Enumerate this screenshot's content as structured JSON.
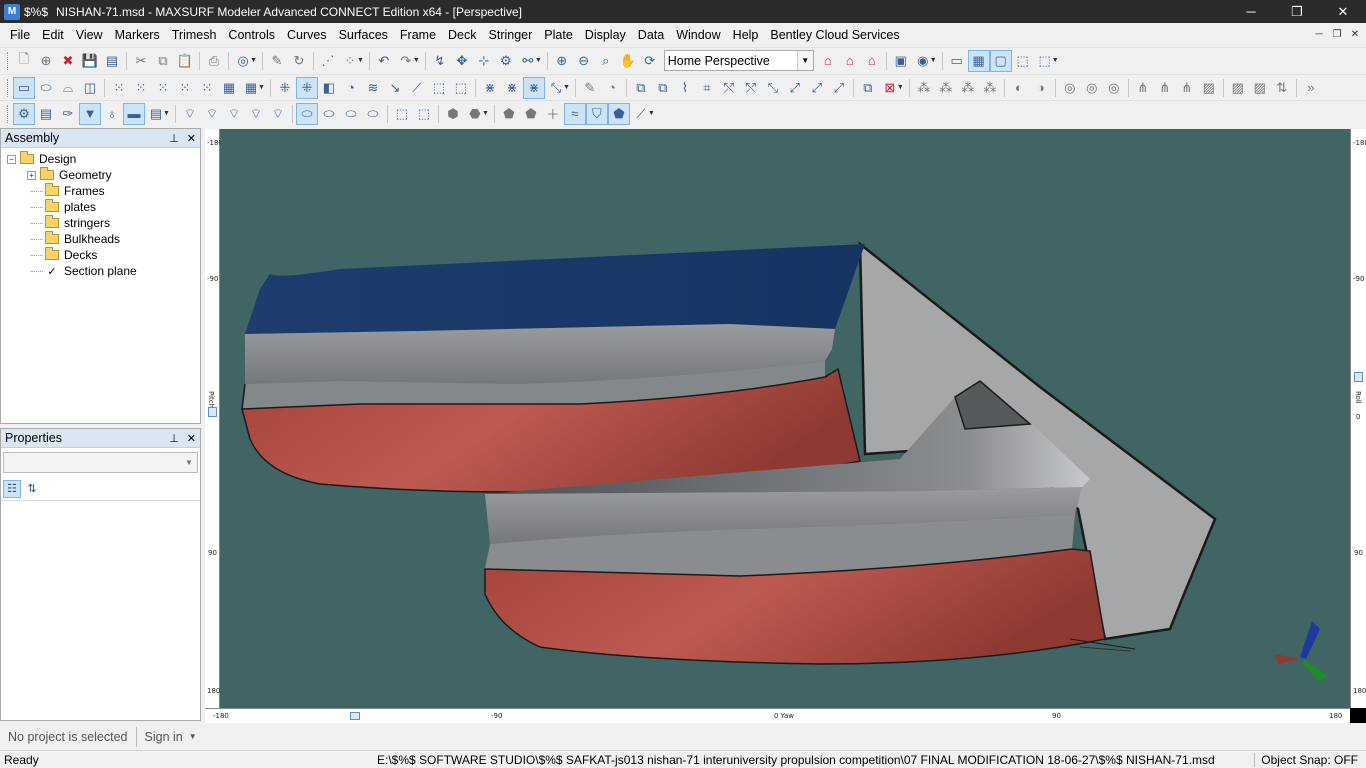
{
  "window": {
    "app_icon_text": "$%$",
    "title": "NISHAN-71.msd - MAXSURF Modeler Advanced CONNECT Edition x64 - [Perspective]"
  },
  "menu": [
    "File",
    "Edit",
    "View",
    "Markers",
    "Trimesh",
    "Controls",
    "Curves",
    "Surfaces",
    "Frame",
    "Deck",
    "Stringer",
    "Plate",
    "Display",
    "Data",
    "Window",
    "Help",
    "Bentley Cloud Services"
  ],
  "toolbar": {
    "view_select_value": "Home Perspective"
  },
  "assembly_panel": {
    "title": "Assembly",
    "tree": [
      {
        "label": "Design",
        "level": 0,
        "icon": "folder-icon",
        "expander": "−"
      },
      {
        "label": "Geometry",
        "level": 1,
        "icon": "folder-icon",
        "expander": "+"
      },
      {
        "label": "Frames",
        "level": 1,
        "icon": "folder-icon"
      },
      {
        "label": "plates",
        "level": 1,
        "icon": "folder-icon"
      },
      {
        "label": "stringers",
        "level": 1,
        "icon": "folder-icon"
      },
      {
        "label": "Bulkheads",
        "level": 1,
        "icon": "folder-icon"
      },
      {
        "label": "Decks",
        "level": 1,
        "icon": "folder-icon"
      },
      {
        "label": "Section plane",
        "level": 1,
        "icon": "checkmark-icon"
      }
    ]
  },
  "properties_panel": {
    "title": "Properties",
    "select_value": ""
  },
  "viewport": {
    "left_ruler": [
      "-180",
      "-90",
      "Pitch",
      "90",
      "180"
    ],
    "right_ruler": [
      "-180",
      "-90",
      "Roll",
      "0",
      "90",
      "180"
    ],
    "bottom_ruler": [
      "-180",
      "-90",
      "0 Yaw",
      "90",
      "180"
    ],
    "colors": {
      "background": "#416465",
      "hull_red": "#b5534b",
      "hull_grey": "#8a8c8f",
      "deck_blue": "#1f3f73",
      "transom_grey": "#a9a9a9"
    }
  },
  "account": {
    "project": "No project is selected",
    "signin": "Sign in"
  },
  "status": {
    "left": "Ready",
    "path": "E:\\$%$   SOFTWARE STUDIO\\$%$   SAFKAT-js013 nishan-71 interuniversity propulsion competition\\07 FINAL MODIFICATION 18-06-27\\$%$   NISHAN-71.msd",
    "snap": "Object Snap: OFF"
  }
}
